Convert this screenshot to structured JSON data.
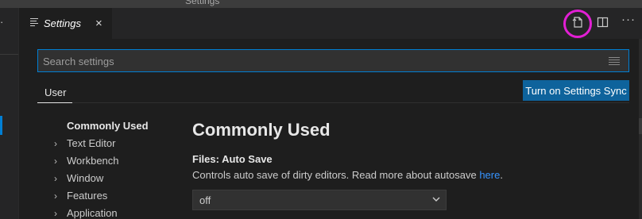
{
  "window": {
    "title": "Settings"
  },
  "tab": {
    "label": "Settings",
    "close_glyph": "×"
  },
  "editor_actions": {
    "open_json_icon": "open-settings-json-icon",
    "split_icon": "split-editor-icon",
    "more_glyph": "···",
    "highlight_color": "#e21fd4"
  },
  "search": {
    "placeholder": "Search settings",
    "value": ""
  },
  "scope": {
    "active": "User"
  },
  "sync_button": {
    "label": "Turn on Settings Sync"
  },
  "toc": {
    "items": [
      {
        "label": "Commonly Used",
        "expandable": false,
        "active": true
      },
      {
        "label": "Text Editor",
        "expandable": true,
        "active": false
      },
      {
        "label": "Workbench",
        "expandable": true,
        "active": false
      },
      {
        "label": "Window",
        "expandable": true,
        "active": false
      },
      {
        "label": "Features",
        "expandable": true,
        "active": false
      },
      {
        "label": "Application",
        "expandable": true,
        "active": false
      }
    ]
  },
  "section": {
    "title": "Commonly Used"
  },
  "setting": {
    "category": "Files: ",
    "name": "Auto Save",
    "description": "Controls auto save of dirty editors. Read more about autosave ",
    "link_text": "here",
    "description_end": ".",
    "value": "off"
  },
  "colors": {
    "background": "#1e1e1e",
    "accent": "#007fd4",
    "button": "#0e639c",
    "link": "#3794ff"
  }
}
